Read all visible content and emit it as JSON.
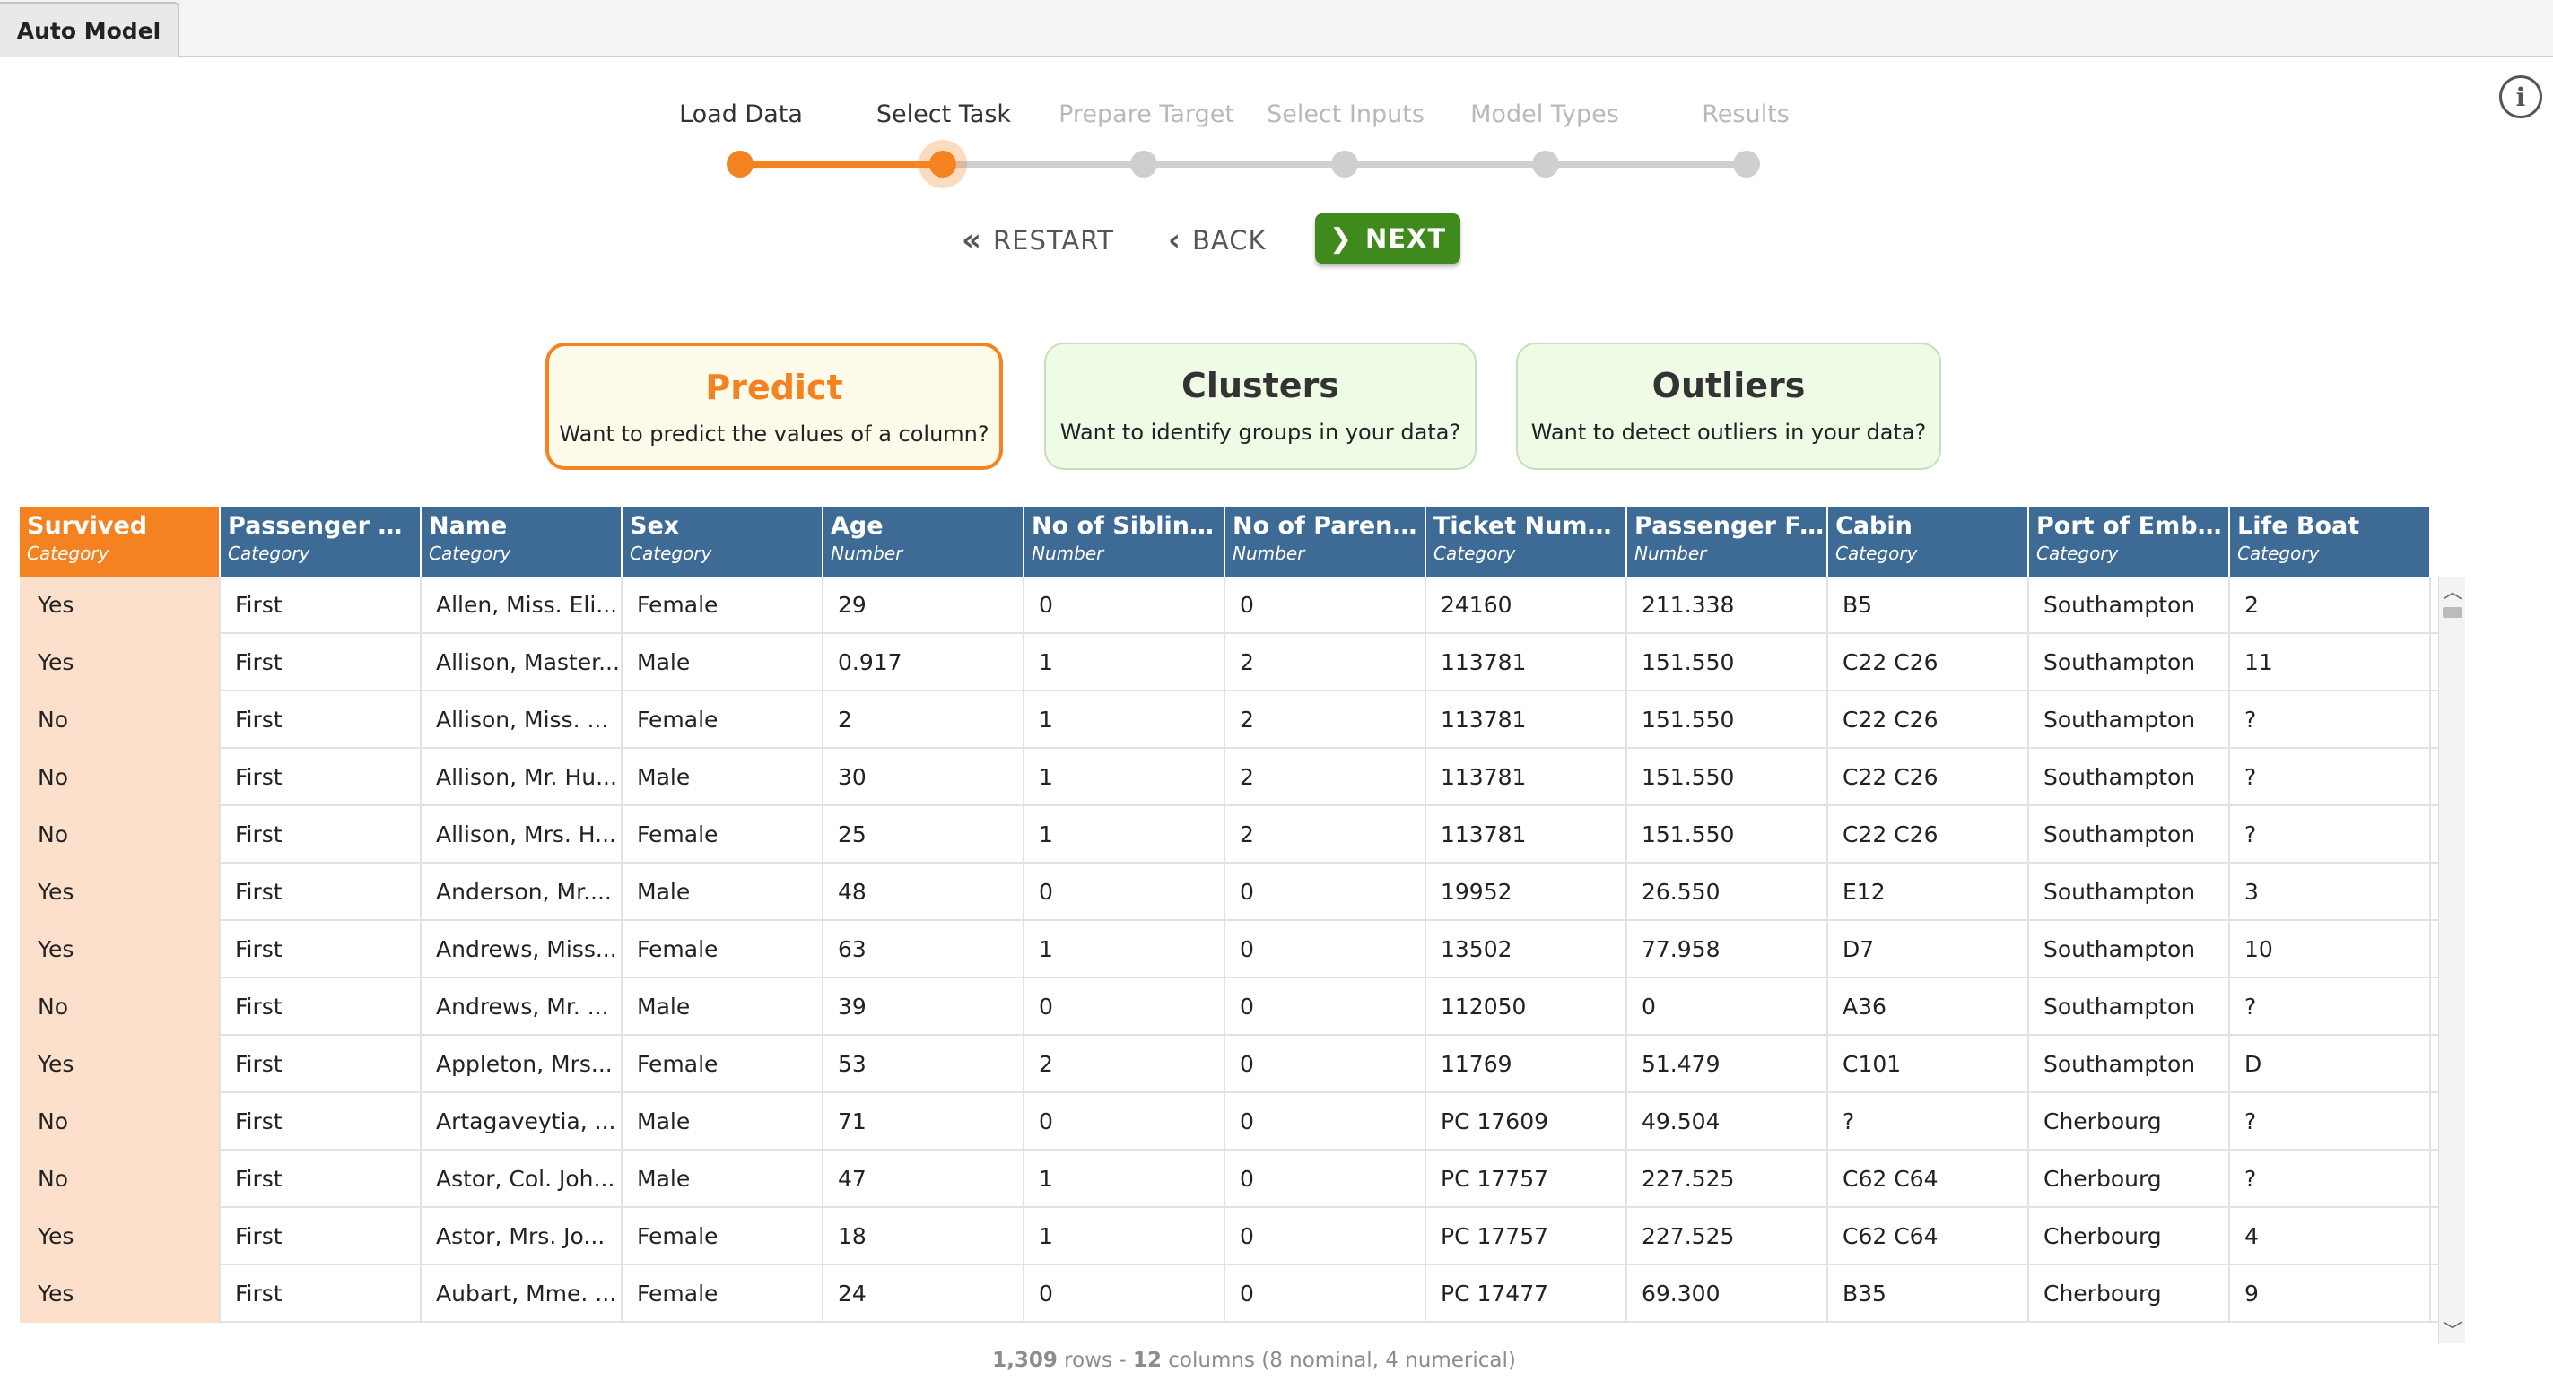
{
  "tab": {
    "label": "Auto Model"
  },
  "stepper": {
    "steps": [
      "Load Data",
      "Select Task",
      "Prepare Target",
      "Select Inputs",
      "Model Types",
      "Results"
    ],
    "current_step": 2
  },
  "nav": {
    "restart": "RESTART",
    "back": "BACK",
    "next": "NEXT"
  },
  "tasks": [
    {
      "title": "Predict",
      "subtitle": "Want to predict the values of a column?"
    },
    {
      "title": "Clusters",
      "subtitle": "Want to identify groups in your data?"
    },
    {
      "title": "Outliers",
      "subtitle": "Want to detect outliers in your data?"
    }
  ],
  "table": {
    "columns": [
      {
        "name": "Survived",
        "type": "Category"
      },
      {
        "name": "Passenger Cl...",
        "type": "Category"
      },
      {
        "name": "Name",
        "type": "Category"
      },
      {
        "name": "Sex",
        "type": "Category"
      },
      {
        "name": "Age",
        "type": "Number"
      },
      {
        "name": "No of Sibling...",
        "type": "Number"
      },
      {
        "name": "No of Parents...",
        "type": "Number"
      },
      {
        "name": "Ticket Numb...",
        "type": "Category"
      },
      {
        "name": "Passenger Fa...",
        "type": "Number"
      },
      {
        "name": "Cabin",
        "type": "Category"
      },
      {
        "name": "Port of Emba...",
        "type": "Category"
      },
      {
        "name": "Life Boat",
        "type": "Category"
      }
    ],
    "rows": [
      [
        "Yes",
        "First",
        "Allen, Miss. Eli...",
        "Female",
        "29",
        "0",
        "0",
        "24160",
        "211.338",
        "B5",
        "Southampton",
        "2"
      ],
      [
        "Yes",
        "First",
        "Allison, Master...",
        "Male",
        "0.917",
        "1",
        "2",
        "113781",
        "151.550",
        "C22 C26",
        "Southampton",
        "11"
      ],
      [
        "No",
        "First",
        "Allison, Miss. ...",
        "Female",
        "2",
        "1",
        "2",
        "113781",
        "151.550",
        "C22 C26",
        "Southampton",
        "?"
      ],
      [
        "No",
        "First",
        "Allison, Mr. Hu...",
        "Male",
        "30",
        "1",
        "2",
        "113781",
        "151.550",
        "C22 C26",
        "Southampton",
        "?"
      ],
      [
        "No",
        "First",
        "Allison, Mrs. H...",
        "Female",
        "25",
        "1",
        "2",
        "113781",
        "151.550",
        "C22 C26",
        "Southampton",
        "?"
      ],
      [
        "Yes",
        "First",
        "Anderson, Mr....",
        "Male",
        "48",
        "0",
        "0",
        "19952",
        "26.550",
        "E12",
        "Southampton",
        "3"
      ],
      [
        "Yes",
        "First",
        "Andrews, Miss...",
        "Female",
        "63",
        "1",
        "0",
        "13502",
        "77.958",
        "D7",
        "Southampton",
        "10"
      ],
      [
        "No",
        "First",
        "Andrews, Mr. ...",
        "Male",
        "39",
        "0",
        "0",
        "112050",
        "0",
        "A36",
        "Southampton",
        "?"
      ],
      [
        "Yes",
        "First",
        "Appleton, Mrs...",
        "Female",
        "53",
        "2",
        "0",
        "11769",
        "51.479",
        "C101",
        "Southampton",
        "D"
      ],
      [
        "No",
        "First",
        "Artagaveytia, ...",
        "Male",
        "71",
        "0",
        "0",
        "PC 17609",
        "49.504",
        "?",
        "Cherbourg",
        "?"
      ],
      [
        "No",
        "First",
        "Astor, Col. Joh...",
        "Male",
        "47",
        "1",
        "0",
        "PC 17757",
        "227.525",
        "C62 C64",
        "Cherbourg",
        "?"
      ],
      [
        "Yes",
        "First",
        "Astor, Mrs. Jo...",
        "Female",
        "18",
        "1",
        "0",
        "PC 17757",
        "227.525",
        "C62 C64",
        "Cherbourg",
        "4"
      ],
      [
        "Yes",
        "First",
        "Aubart, Mme. ...",
        "Female",
        "24",
        "0",
        "0",
        "PC 17477",
        "69.300",
        "B35",
        "Cherbourg",
        "9"
      ]
    ]
  },
  "footer": {
    "rows": "1,309",
    "rows_label": " rows - ",
    "columns": "12",
    "columns_label": " columns (8 nominal, 4 numerical)"
  },
  "colors": {
    "accent": "#f58220",
    "header_blue": "#3e6b96",
    "next_green": "#3f8a1d",
    "target_cell": "#fde0cb",
    "card_green": "#eefbe5"
  },
  "icons": [
    "info-icon",
    "double-chevron-left-icon",
    "chevron-left-icon",
    "chevron-right-icon",
    "scroll-up-icon",
    "scroll-down-icon"
  ]
}
